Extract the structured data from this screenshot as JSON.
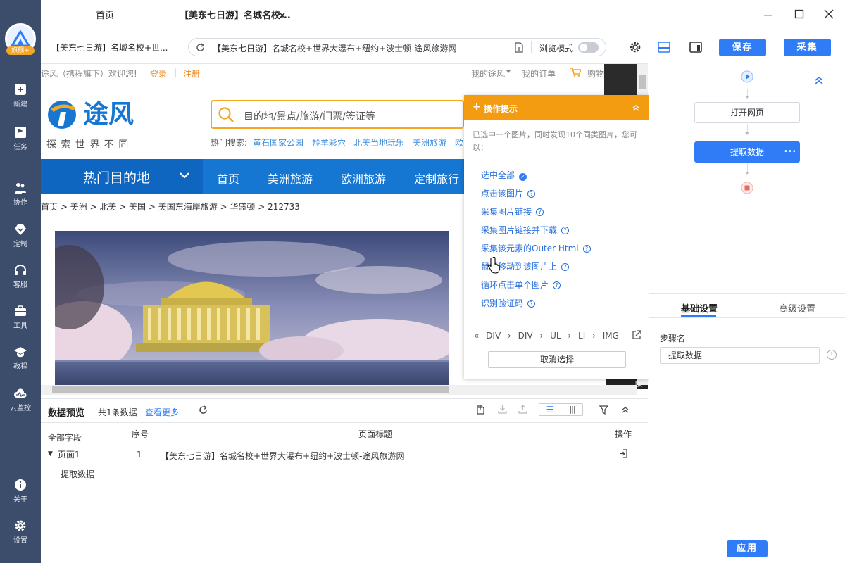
{
  "app": {
    "badge": "旗舰+"
  },
  "rail": [
    {
      "label": "新建",
      "icon": "plus-icon"
    },
    {
      "label": "任务",
      "icon": "task-flag-icon"
    },
    {
      "label": "协作",
      "icon": "team-icon"
    },
    {
      "label": "定制",
      "icon": "heart-diamond-icon"
    },
    {
      "label": "客服",
      "icon": "headset-icon"
    },
    {
      "label": "工具",
      "icon": "toolbox-icon"
    },
    {
      "label": "教程",
      "icon": "graduation-icon"
    },
    {
      "label": "云监控",
      "icon": "cloud-monitor-icon"
    },
    {
      "label": "关于",
      "icon": "info-icon"
    },
    {
      "label": "设置",
      "icon": "gear-icon"
    }
  ],
  "tabs": [
    {
      "label": "首页"
    },
    {
      "label": "【美东七日游】名城名校...",
      "close": "✕"
    }
  ],
  "toolbar": {
    "page_title": "【美东七日游】名城名校+世...",
    "url": "【美东七日游】名城名校+世界大瀑布+纽约+波士顿-途风旅游网",
    "browse_mode": "浏览模式",
    "save": "保存",
    "collect": "采集"
  },
  "site": {
    "welcome": "途风（携程旗下）欢迎您!",
    "login": "登录",
    "sep": "|",
    "register": "注册",
    "my_tuffeng": "我的途风",
    "my_orders": "我的订单",
    "cart": "购物",
    "logo_text": "途风",
    "slogan": "探 索 世 界 不 同",
    "search_placeholder": "目的地/景点/旅游/门票/签证等",
    "hot_label": "热门搜索:",
    "hot": [
      "黄石国家公园",
      "羚羊彩穴",
      "北美当地玩乐",
      "美洲旅游",
      "欧"
    ],
    "nav_title": "热门目的地",
    "nav": [
      "首页",
      "美洲旅游",
      "欧洲旅游",
      "定制旅行"
    ],
    "breadcrumb": "首页 > 美洲 > 北美 > 美国 > 美国东海岸旅游 > 华盛顿 > 212733",
    "photo_tag": "欧"
  },
  "popup": {
    "title": "操作提示",
    "desc": "已选中一个图片，同时发现10个同类图片，您可以：",
    "items": [
      "选中全部",
      "点击该图片",
      "采集图片链接",
      "采集图片链接并下载",
      "采集该元素的Outer Html",
      "鼠标移动到该图片上",
      "循环点击单个图片",
      "识别验证码"
    ],
    "path": [
      "DIV",
      "DIV",
      "UL",
      "LI",
      "IMG"
    ],
    "cancel": "取消选择"
  },
  "preview": {
    "title": "数据预览",
    "count": "共1条数据",
    "more": "查看更多",
    "fields_title": "全部字段",
    "page": "页面1",
    "field": "提取数据",
    "col_index": "序号",
    "col_title": "页面标题",
    "col_action": "操作",
    "rows": [
      {
        "index": "1",
        "title": "【美东七日游】名城名校+世界大瀑布+纽约+波士顿-途风旅游网"
      }
    ]
  },
  "flow": {
    "step1": "打开网页",
    "step2": "提取数据",
    "more": "•••"
  },
  "settings": {
    "tab_basic": "基础设置",
    "tab_advanced": "高级设置",
    "step_name_label": "步骤名",
    "step_name_value": "提取数据",
    "apply": "应用"
  },
  "colors": {
    "accent": "#2f7cf6",
    "rail": "#3c4d6b",
    "popup": "#f39c12",
    "site_nav": "#1677d2",
    "site_orange": "#f5a623"
  }
}
